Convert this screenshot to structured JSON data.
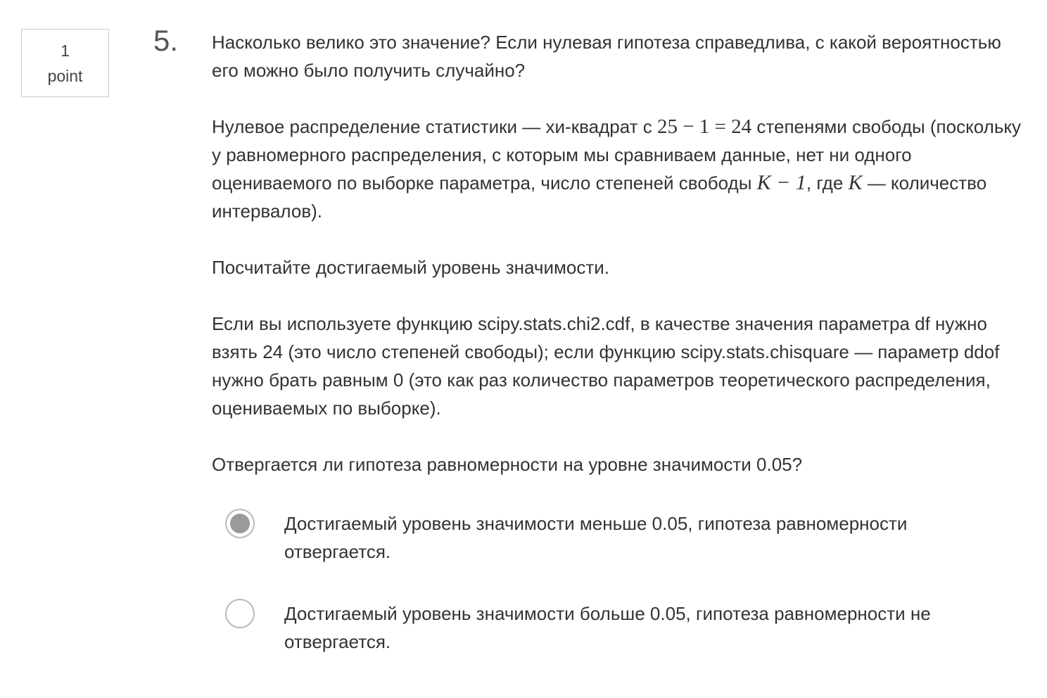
{
  "points": {
    "value": "1",
    "label": "point"
  },
  "question": {
    "number": "5.",
    "p1": "Насколько велико это значение? Если нулевая гипотеза справедлива, с какой вероятностью его можно было получить случайно?",
    "p2": {
      "a": "Нулевое распределение статистики — хи-квадрат с ",
      "m1": "25 − 1 = 24",
      "b": " степенями свободы (поскольку у равномерного распределения, с которым мы сравниваем данные, нет ни одного оцениваемого по выборке параметра, число степеней свободы ",
      "m2": "K − 1",
      "c": ", где ",
      "m3": "K",
      "d": " — количество интервалов)."
    },
    "p3": "Посчитайте достигаемый уровень значимости.",
    "p4": "Если вы используете функцию scipy.stats.chi2.cdf, в качестве значения параметра df нужно взять 24 (это число степеней свободы); если функцию scipy.stats.chisquare — параметр ddof нужно брать равным 0 (это как раз количество параметров теоретического распределения, оцениваемых по выборке).",
    "p5": "Отвергается ли гипотеза равномерности на уровне значимости 0.05?"
  },
  "options": [
    {
      "label": "Достигаемый уровень значимости меньше 0.05, гипотеза равномерности отвергается.",
      "selected": true
    },
    {
      "label": "Достигаемый уровень значимости больше 0.05, гипотеза равномерности не отвергается.",
      "selected": false
    }
  ]
}
